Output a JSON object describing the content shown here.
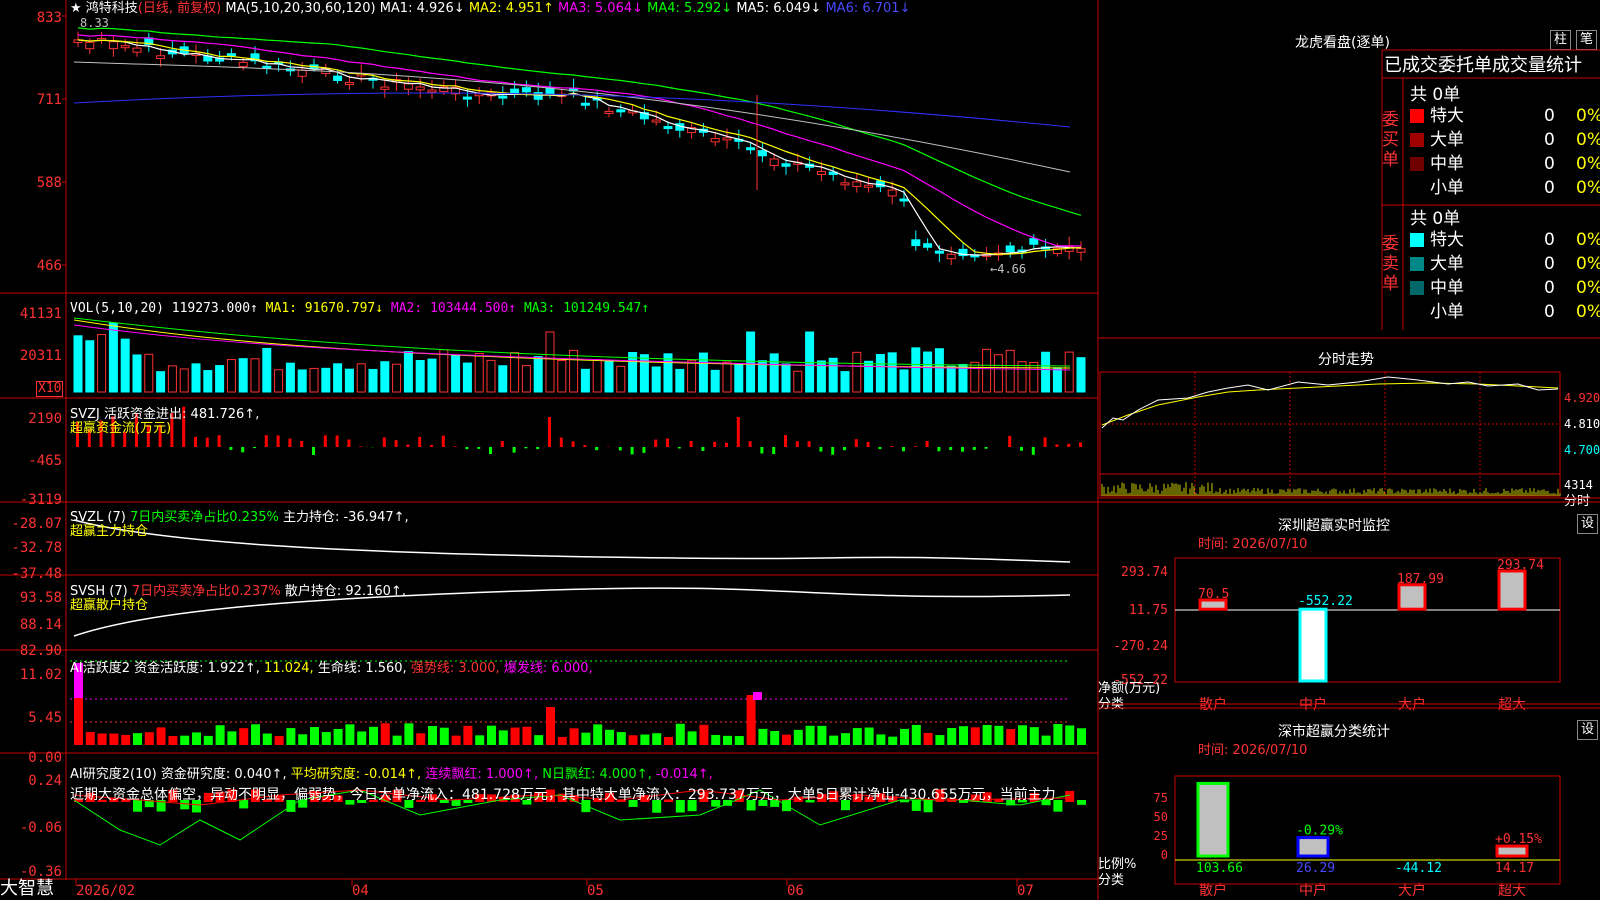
{
  "header": {
    "star": "★",
    "name": "鸿特科技",
    "period": "(日线, 前复权)",
    "ma_label": "MA(5,10,20,30,60,120)",
    "ma1": "MA1: 4.926↓",
    "ma2": "MA2: 4.951↑",
    "ma3": "MA3: 5.064↓",
    "ma4": "MA4: 5.292↓",
    "ma5": "MA5: 6.049↓",
    "ma6": "MA6: 6.701↓",
    "max_label": "8.33",
    "min_label": "←4.66"
  },
  "price_axis": [
    "833",
    "711",
    "588",
    "466"
  ],
  "vol": {
    "title": "VOL(5,10,20)",
    "val": "119273.000↑",
    "ma1": "MA1: 91670.797↓",
    "ma2": "MA2: 103444.500↑",
    "ma3": "MA3: 101249.547↑",
    "axis": [
      "41131",
      "20311"
    ],
    "unit": "X10"
  },
  "svzj": {
    "title": "SVZJ",
    "text": "活跃资金进出: 481.726↑,",
    "sub": "超赢资金流(万元)",
    "axis": [
      "2190",
      "-465",
      "-3119"
    ]
  },
  "svzl": {
    "title": "SVZL (7)",
    "text1": "7日内买卖净占比0.235%",
    "text2": "主力持仓: -36.947↑,",
    "sub": "超赢主力持仓",
    "axis": [
      "-28.07",
      "-32.78",
      "-37.48"
    ]
  },
  "svsh": {
    "title": "SVSH (7)",
    "text1": "7日内买卖净占比0.237%",
    "text2": "散户持仓: 92.160↑,",
    "sub": "超赢散户持仓",
    "axis": [
      "93.58",
      "88.14",
      "82.90"
    ]
  },
  "ai1": {
    "title": "AI活跃度2",
    "t1": "资金活跃度: 1.922↑,",
    "t2": "11.024,",
    "t3": "生命线: 1.560,",
    "t4": "强势线: 3.000,",
    "t5": "爆发线: 6.000,",
    "axis": [
      "11.02",
      "5.45",
      "0.00"
    ]
  },
  "ai2": {
    "title": "AI研究度2(10)",
    "t1": "资金研究度: 0.040↑,",
    "t2": "平均研究度: -0.014↑,",
    "t3": "连续飘红: 1.000↑,",
    "t4": "N日飘红: 4.000↑,",
    "t5": "-0.014↑,",
    "msg": "近期大资金总体偏空，异动不明显，偏弱势，今日大单净流入：481.728万元，其中特大单净流入：293.737万元，大单5日累计净出-430.655万元，当前主力",
    "axis": [
      "0.24",
      "-0.06",
      "-0.36"
    ]
  },
  "bottom": {
    "brand": "大智慧",
    "dates": [
      "2026/02",
      "04",
      "05",
      "06",
      "07"
    ]
  },
  "right": {
    "lhb_title": "龙虎看盘(逐单)",
    "btn_zhu": "柱",
    "btn_bi": "笔",
    "tabs": "已成交委托单成交量统计",
    "buy_label": "委买单",
    "sell_label": "委卖单",
    "buy_total": "共 0单",
    "sell_total": "共 0单",
    "buy_rows": [
      {
        "name": "特大",
        "v": "0",
        "p": "0%",
        "color": "#ff0000"
      },
      {
        "name": "大单",
        "v": "0",
        "p": "0%",
        "color": "#a00000"
      },
      {
        "name": "中单",
        "v": "0",
        "p": "0%",
        "color": "#700000"
      },
      {
        "name": "小单",
        "v": "0",
        "p": "0%",
        "color": "#000000"
      }
    ],
    "sell_rows": [
      {
        "name": "特大",
        "v": "0",
        "p": "0%",
        "color": "#00ffff"
      },
      {
        "name": "大单",
        "v": "0",
        "p": "0%",
        "color": "#008888"
      },
      {
        "name": "中单",
        "v": "0",
        "p": "0%",
        "color": "#006868"
      },
      {
        "name": "小单",
        "v": "0",
        "p": "0%",
        "color": "#000000"
      }
    ],
    "fs_title": "分时走势",
    "fs_axis": [
      "4.920",
      "4.810",
      "4.700"
    ],
    "fs_vol": "4314",
    "fs_vol_label": "分时",
    "monitor": {
      "title": "深圳超赢实时监控",
      "btn": "设",
      "time": "时间: 2026/07/10",
      "axis": [
        "293.74",
        "11.75",
        "-270.24",
        "-552.22"
      ],
      "ylabel": "净额(万元)",
      "xlabel": "分类",
      "cats": [
        "散户",
        "中户",
        "大户",
        "超大"
      ],
      "values": [
        70.5,
        -552.22,
        187.99,
        293.74
      ],
      "value_labels": [
        "70.5",
        "-552.22",
        "187.99",
        "293.74"
      ]
    },
    "stats": {
      "title": "深市超赢分类统计",
      "btn": "设",
      "time": "时间: 2026/07/10",
      "axis": [
        "75",
        "50",
        "25",
        "0"
      ],
      "ylabel": "比例%",
      "xlabel": "分类",
      "cats": [
        "散户",
        "中户",
        "大户",
        "超大"
      ],
      "bar_labels": [
        "",
        "-0.29%",
        "",
        "+0.15%"
      ],
      "values": [
        103.66,
        26.29,
        -44.12,
        14.17
      ],
      "value_labels": [
        "103.66",
        "26.29",
        "-44.12",
        "14.17"
      ]
    }
  },
  "chart_data": [
    {
      "type": "bar",
      "title": "",
      "categories": [
        "散户",
        "中户",
        "大户",
        "超大"
      ],
      "values": [
        70.5,
        -552.22,
        187.99,
        293.74
      ],
      "ylabel": "净额(万元)",
      "ylim": [
        -552.22,
        293.74
      ]
    },
    {
      "type": "bar",
      "title": "",
      "categories": [
        "散户",
        "中户",
        "大户",
        "超大"
      ],
      "values": [
        103.66,
        26.29,
        -44.12,
        14.17
      ],
      "ylabel": "比例%"
    }
  ]
}
